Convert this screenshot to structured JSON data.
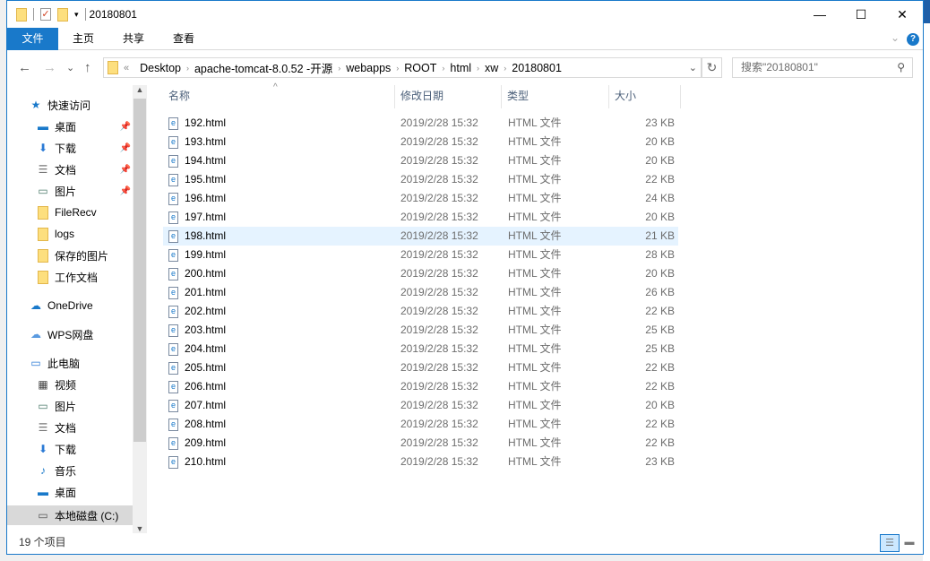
{
  "window": {
    "title": "20180801",
    "minimize": "—",
    "maximize": "☐",
    "close": "✕"
  },
  "ribbon": {
    "tabs": [
      "文件",
      "主页",
      "共享",
      "查看"
    ],
    "help": "?",
    "expand": "⌄"
  },
  "nav": {
    "back": "←",
    "forward": "→",
    "recent": "⌄",
    "up": "↑",
    "breadcrumb": [
      "Desktop",
      "apache-tomcat-8.0.52 -开源",
      "webapps",
      "ROOT",
      "html",
      "xw",
      "20180801"
    ],
    "overflow": "«",
    "refresh": "↻",
    "search_placeholder": "搜索\"20180801\""
  },
  "sidebar": {
    "items": [
      {
        "label": "快速访问",
        "icon": "star-icon",
        "level": 0
      },
      {
        "label": "桌面",
        "icon": "desktop-icon",
        "level": 1,
        "pinned": true
      },
      {
        "label": "下载",
        "icon": "download-icon",
        "level": 1,
        "pinned": true
      },
      {
        "label": "文档",
        "icon": "document-icon",
        "level": 1,
        "pinned": true
      },
      {
        "label": "图片",
        "icon": "picture-icon",
        "level": 1,
        "pinned": true
      },
      {
        "label": "FileRecv",
        "icon": "folder-icon",
        "level": 1
      },
      {
        "label": "logs",
        "icon": "folder-icon",
        "level": 1
      },
      {
        "label": "保存的图片",
        "icon": "folder-icon",
        "level": 1
      },
      {
        "label": "工作文档",
        "icon": "folder-icon",
        "level": 1
      },
      {
        "label": "OneDrive",
        "icon": "cloud-icon",
        "level": 0
      },
      {
        "label": "WPS网盘",
        "icon": "cloud-outline-icon",
        "level": 0
      },
      {
        "label": "此电脑",
        "icon": "computer-icon",
        "level": 0
      },
      {
        "label": "视频",
        "icon": "video-icon",
        "level": 1
      },
      {
        "label": "图片",
        "icon": "picture-icon",
        "level": 1
      },
      {
        "label": "文档",
        "icon": "document-icon",
        "level": 1
      },
      {
        "label": "下载",
        "icon": "download-icon",
        "level": 1
      },
      {
        "label": "音乐",
        "icon": "music-icon",
        "level": 1
      },
      {
        "label": "桌面",
        "icon": "desktop-icon",
        "level": 1
      },
      {
        "label": "本地磁盘 (C:)",
        "icon": "drive-icon",
        "level": 1,
        "selected": true
      }
    ]
  },
  "columns": [
    "名称",
    "修改日期",
    "类型",
    "大小"
  ],
  "files": [
    {
      "name": "192.html",
      "date": "2019/2/28 15:32",
      "type": "HTML 文件",
      "size": "23 KB"
    },
    {
      "name": "193.html",
      "date": "2019/2/28 15:32",
      "type": "HTML 文件",
      "size": "20 KB"
    },
    {
      "name": "194.html",
      "date": "2019/2/28 15:32",
      "type": "HTML 文件",
      "size": "20 KB"
    },
    {
      "name": "195.html",
      "date": "2019/2/28 15:32",
      "type": "HTML 文件",
      "size": "22 KB"
    },
    {
      "name": "196.html",
      "date": "2019/2/28 15:32",
      "type": "HTML 文件",
      "size": "24 KB"
    },
    {
      "name": "197.html",
      "date": "2019/2/28 15:32",
      "type": "HTML 文件",
      "size": "20 KB"
    },
    {
      "name": "198.html",
      "date": "2019/2/28 15:32",
      "type": "HTML 文件",
      "size": "21 KB",
      "hover": true
    },
    {
      "name": "199.html",
      "date": "2019/2/28 15:32",
      "type": "HTML 文件",
      "size": "28 KB"
    },
    {
      "name": "200.html",
      "date": "2019/2/28 15:32",
      "type": "HTML 文件",
      "size": "20 KB"
    },
    {
      "name": "201.html",
      "date": "2019/2/28 15:32",
      "type": "HTML 文件",
      "size": "26 KB"
    },
    {
      "name": "202.html",
      "date": "2019/2/28 15:32",
      "type": "HTML 文件",
      "size": "22 KB"
    },
    {
      "name": "203.html",
      "date": "2019/2/28 15:32",
      "type": "HTML 文件",
      "size": "25 KB"
    },
    {
      "name": "204.html",
      "date": "2019/2/28 15:32",
      "type": "HTML 文件",
      "size": "25 KB"
    },
    {
      "name": "205.html",
      "date": "2019/2/28 15:32",
      "type": "HTML 文件",
      "size": "22 KB"
    },
    {
      "name": "206.html",
      "date": "2019/2/28 15:32",
      "type": "HTML 文件",
      "size": "22 KB"
    },
    {
      "name": "207.html",
      "date": "2019/2/28 15:32",
      "type": "HTML 文件",
      "size": "20 KB"
    },
    {
      "name": "208.html",
      "date": "2019/2/28 15:32",
      "type": "HTML 文件",
      "size": "22 KB"
    },
    {
      "name": "209.html",
      "date": "2019/2/28 15:32",
      "type": "HTML 文件",
      "size": "22 KB"
    },
    {
      "name": "210.html",
      "date": "2019/2/28 15:32",
      "type": "HTML 文件",
      "size": "23 KB"
    }
  ],
  "status": {
    "count": "19 个项目"
  },
  "colors": {
    "accent": "#1979ca",
    "hover": "#e5f3ff",
    "folder": "#fddf7e"
  }
}
